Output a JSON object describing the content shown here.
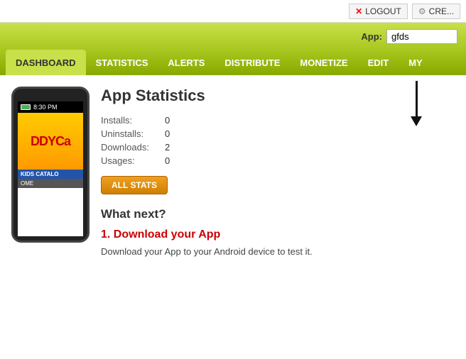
{
  "topBar": {
    "logout_label": "LOGOUT",
    "create_label": "CRE..."
  },
  "appBar": {
    "app_label": "App:",
    "app_value": "gfds"
  },
  "nav": {
    "tabs": [
      {
        "id": "dashboard",
        "label": "DASHBOARD",
        "active": true
      },
      {
        "id": "statistics",
        "label": "STATISTICS",
        "active": false
      },
      {
        "id": "alerts",
        "label": "ALERTS",
        "active": false
      },
      {
        "id": "distribute",
        "label": "DISTRIBUTE",
        "active": false
      },
      {
        "id": "monetize",
        "label": "MONETIZE",
        "active": false
      },
      {
        "id": "edit",
        "label": "EDIT",
        "active": false
      },
      {
        "id": "my",
        "label": "MY",
        "active": false
      }
    ]
  },
  "phone": {
    "time": "8:30 PM",
    "app_text": "DDYCa",
    "sub_text": "KIDS CATALO",
    "home_text": "OME"
  },
  "stats": {
    "title": "App Statistics",
    "rows": [
      {
        "label": "Installs:",
        "value": "0"
      },
      {
        "label": "Uninstalls:",
        "value": "0"
      },
      {
        "label": "Downloads:",
        "value": "2"
      },
      {
        "label": "Usages:",
        "value": "0"
      }
    ],
    "all_stats_label": "ALL STATS"
  },
  "whatNext": {
    "heading": "What next?",
    "download_heading": "1. Download your App",
    "download_text": "Download your App to your Android device to test it."
  }
}
